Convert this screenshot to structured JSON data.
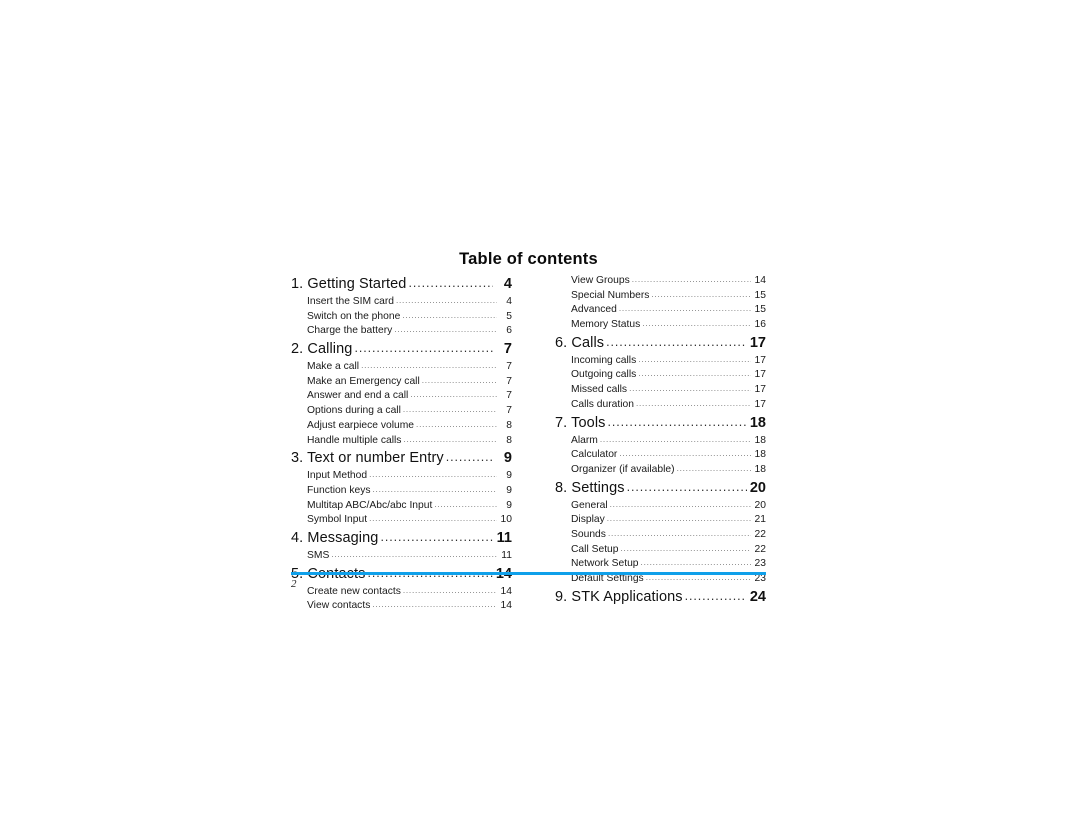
{
  "page": {
    "title": "Table of contents",
    "page_number": "2",
    "rule_color": "#0fa0ea"
  },
  "columns": [
    {
      "name": "left-column",
      "entries": [
        {
          "level": 1,
          "label": "1. Getting Started",
          "page": "4"
        },
        {
          "level": 2,
          "label": "Insert the SIM card",
          "page": "4"
        },
        {
          "level": 2,
          "label": "Switch on the phone",
          "page": "5"
        },
        {
          "level": 2,
          "label": "Charge the battery",
          "page": "6"
        },
        {
          "level": 1,
          "label": "2. Calling",
          "page": "7"
        },
        {
          "level": 2,
          "label": "Make a call",
          "page": "7"
        },
        {
          "level": 2,
          "label": "Make an Emergency call",
          "page": "7"
        },
        {
          "level": 2,
          "label": "Answer and end a call",
          "page": "7"
        },
        {
          "level": 2,
          "label": "Options during a call",
          "page": "7"
        },
        {
          "level": 2,
          "label": "Adjust earpiece volume",
          "page": "8"
        },
        {
          "level": 2,
          "label": "Handle multiple calls",
          "page": "8"
        },
        {
          "level": 1,
          "label": "3. Text or number Entry",
          "page": "9"
        },
        {
          "level": 2,
          "label": "Input Method",
          "page": "9"
        },
        {
          "level": 2,
          "label": "Function keys",
          "page": "9"
        },
        {
          "level": 2,
          "label": "Multitap ABC/Abc/abc Input",
          "page": "9"
        },
        {
          "level": 2,
          "label": "Symbol Input",
          "page": "10"
        },
        {
          "level": 1,
          "label": "4. Messaging",
          "page": "11"
        },
        {
          "level": 2,
          "label": "SMS",
          "page": "11"
        },
        {
          "level": 1,
          "label": "5. Contacts",
          "page": "14"
        },
        {
          "level": 2,
          "label": "Create new contacts",
          "page": "14"
        },
        {
          "level": 2,
          "label": "View contacts",
          "page": "14"
        }
      ]
    },
    {
      "name": "right-column",
      "entries": [
        {
          "level": 2,
          "label": "View Groups",
          "page": "14"
        },
        {
          "level": 2,
          "label": "Special Numbers",
          "page": "15"
        },
        {
          "level": 2,
          "label": "Advanced",
          "page": "15"
        },
        {
          "level": 2,
          "label": "Memory Status",
          "page": "16"
        },
        {
          "level": 1,
          "label": "6. Calls",
          "page": "17"
        },
        {
          "level": 2,
          "label": "Incoming calls",
          "page": "17"
        },
        {
          "level": 2,
          "label": "Outgoing calls",
          "page": "17"
        },
        {
          "level": 2,
          "label": "Missed calls",
          "page": "17"
        },
        {
          "level": 2,
          "label": "Calls duration",
          "page": "17"
        },
        {
          "level": 1,
          "label": "7. Tools",
          "page": "18"
        },
        {
          "level": 2,
          "label": "Alarm",
          "page": "18"
        },
        {
          "level": 2,
          "label": "Calculator",
          "page": "18"
        },
        {
          "level": 2,
          "label": "Organizer (if available)",
          "page": "18"
        },
        {
          "level": 1,
          "label": "8. Settings",
          "page": "20"
        },
        {
          "level": 2,
          "label": "General",
          "page": "20"
        },
        {
          "level": 2,
          "label": "Display",
          "page": "21"
        },
        {
          "level": 2,
          "label": "Sounds",
          "page": "22"
        },
        {
          "level": 2,
          "label": "Call Setup",
          "page": "22"
        },
        {
          "level": 2,
          "label": "Network Setup",
          "page": "23"
        },
        {
          "level": 2,
          "label": "Default Settings",
          "page": "23"
        },
        {
          "level": 1,
          "label": "9. STK Applications",
          "page": "24"
        }
      ]
    }
  ]
}
